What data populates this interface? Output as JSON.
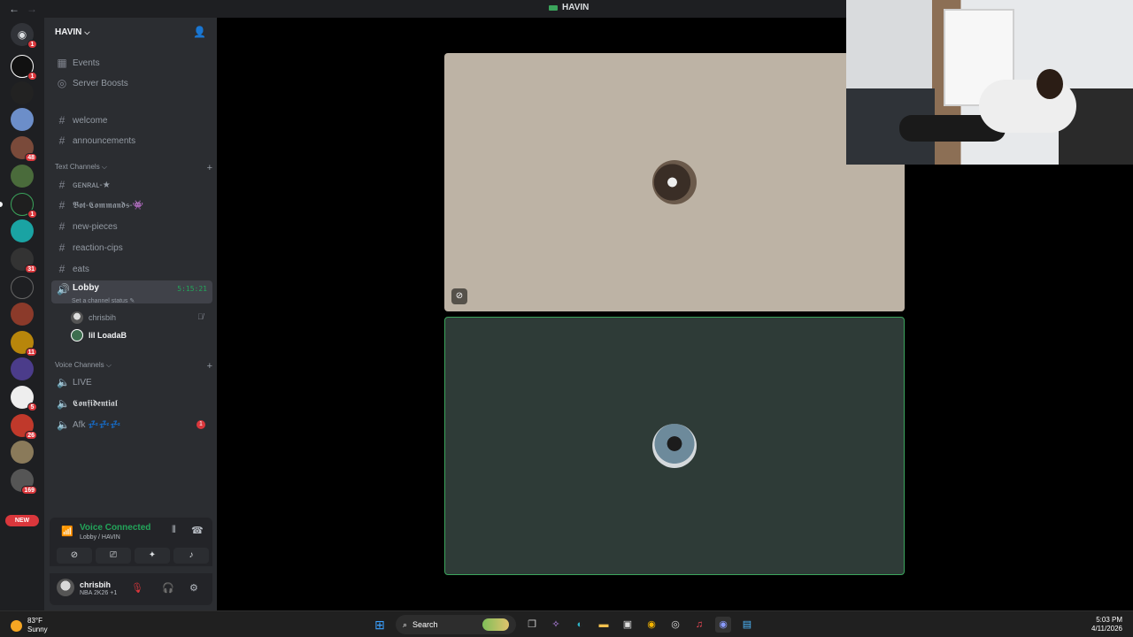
{
  "window": {
    "title": "HAVIN",
    "back": "←",
    "forward": "→"
  },
  "server": {
    "name": "HAVIN"
  },
  "guild_badges": [
    "1",
    "1",
    "",
    "48",
    "",
    "1",
    "",
    "31",
    "",
    "",
    "11",
    "",
    "5",
    "26",
    "",
    "169"
  ],
  "new_label": "NEW",
  "nav_items": [
    {
      "icon": "▦",
      "label": "Events"
    },
    {
      "icon": "◎",
      "label": "Server Boosts"
    }
  ],
  "top_channels": [
    {
      "label": "welcome"
    },
    {
      "label": "announcements"
    }
  ],
  "text_category": "Text Channels",
  "text_channels": [
    {
      "label": "ɢᴇɴʀᴀʟ-★"
    },
    {
      "label": "𝕭𝖔𝖙-𝕮𝖔𝖒𝖒𝖆𝖓𝖉𝖘-👾"
    },
    {
      "label": "new-pieces"
    },
    {
      "label": "reaction-cips"
    },
    {
      "label": "eats"
    }
  ],
  "lobby": {
    "label": "Lobby",
    "timer": "5:15:21",
    "status_hint": "Set a channel status ✎",
    "members": [
      {
        "name": "chrisbih",
        "muted": "🎙̸"
      },
      {
        "name": "lil LoadaB"
      }
    ]
  },
  "voice_category": "Voice Channels",
  "voice_channels": [
    {
      "label": "LIVE"
    },
    {
      "label": "𝕮𝖔𝖓𝖋𝖎𝖉𝖊𝖓𝖙𝖎𝖆𝖑"
    },
    {
      "label": "Afk 💤💤💤",
      "badge": "1"
    }
  ],
  "voice_panel": {
    "status": "Voice Connected",
    "location": "Lobby / HAVIN"
  },
  "user_panel": {
    "name": "chrisbih",
    "status": "NBA 2K26 +1"
  },
  "taskbar": {
    "weather_temp": "83°F",
    "weather_desc": "Sunny",
    "search_label": "Search",
    "time": "5:03 PM",
    "date": "4/11/2026"
  },
  "colors": {
    "accent_green": "#23a55a",
    "badge_red": "#da373c",
    "sidebar_bg": "#2b2d31",
    "guild_bg": "#1e1f22"
  }
}
